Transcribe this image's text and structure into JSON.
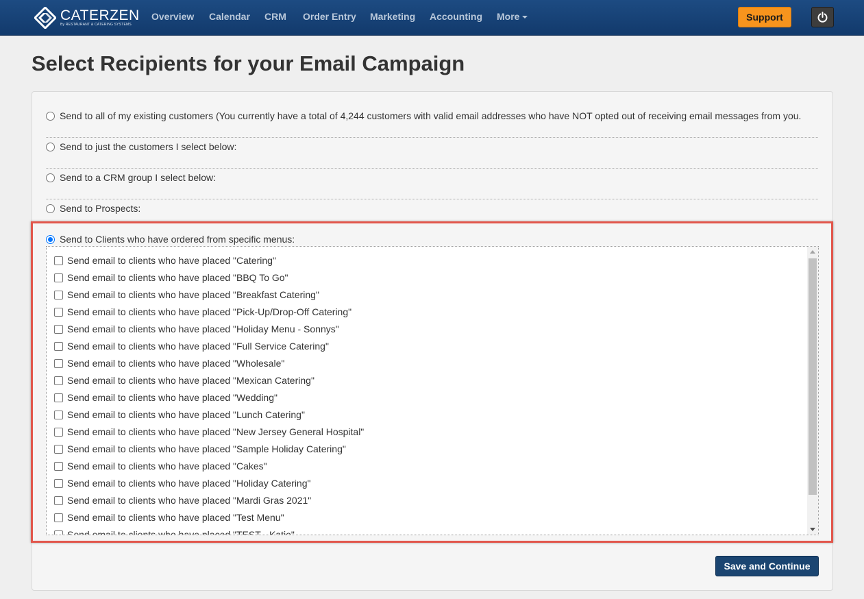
{
  "app": {
    "logo_name": "CATERZEN",
    "logo_sub": "By RESTAURANT & CATERING SYSTEMS"
  },
  "nav": {
    "items": [
      {
        "label": "Overview"
      },
      {
        "label": "Calendar"
      },
      {
        "label": "CRM"
      },
      {
        "label": "Order Entry"
      },
      {
        "label": "Marketing"
      },
      {
        "label": "Accounting"
      },
      {
        "label": "More"
      }
    ],
    "support_label": "Support",
    "power_icon": "power-icon"
  },
  "colors": {
    "navbar": "#1d4b82",
    "support": "#f7941d",
    "primary_button": "#1b4571",
    "highlight_border": "#e2574c",
    "radio_selected": "#0075ff"
  },
  "page": {
    "title": "Select Recipients for your Email Campaign"
  },
  "recipient_options": [
    {
      "label": "Send to all of my existing customers (You currently have a total of 4,244 customers with valid email addresses who have NOT opted out of receiving email messages from you.",
      "selected": false
    },
    {
      "label": "Send to just the customers I select below:",
      "selected": false
    },
    {
      "label": "Send to a CRM group I select below:",
      "selected": false
    },
    {
      "label": "Send to Prospects:",
      "selected": false
    },
    {
      "label": "Send to Clients who have ordered from specific menus:",
      "selected": true
    }
  ],
  "menus": [
    {
      "label": "Send email to clients who have placed \"Catering\"",
      "checked": false
    },
    {
      "label": "Send email to clients who have placed \"BBQ To Go\"",
      "checked": false
    },
    {
      "label": "Send email to clients who have placed \"Breakfast Catering\"",
      "checked": false
    },
    {
      "label": "Send email to clients who have placed \"Pick-Up/Drop-Off Catering\"",
      "checked": false
    },
    {
      "label": "Send email to clients who have placed \"Holiday Menu - Sonnys\"",
      "checked": false
    },
    {
      "label": "Send email to clients who have placed \"Full Service Catering\"",
      "checked": false
    },
    {
      "label": "Send email to clients who have placed \"Wholesale\"",
      "checked": false
    },
    {
      "label": "Send email to clients who have placed \"Mexican Catering\"",
      "checked": false
    },
    {
      "label": "Send email to clients who have placed \"Wedding\"",
      "checked": false
    },
    {
      "label": "Send email to clients who have placed \"Lunch Catering\"",
      "checked": false
    },
    {
      "label": "Send email to clients who have placed \"New Jersey General Hospital\"",
      "checked": false
    },
    {
      "label": "Send email to clients who have placed \"Sample Holiday Catering\"",
      "checked": false
    },
    {
      "label": "Send email to clients who have placed \"Cakes\"",
      "checked": false
    },
    {
      "label": "Send email to clients who have placed \"Holiday Catering\"",
      "checked": false
    },
    {
      "label": "Send email to clients who have placed \"Mardi Gras 2021\"",
      "checked": false
    },
    {
      "label": "Send email to clients who have placed \"Test Menu\"",
      "checked": false
    },
    {
      "label": "Send email to clients who have placed \"TEST - Katie\"",
      "checked": false
    }
  ],
  "actions": {
    "save_label": "Save and Continue"
  }
}
